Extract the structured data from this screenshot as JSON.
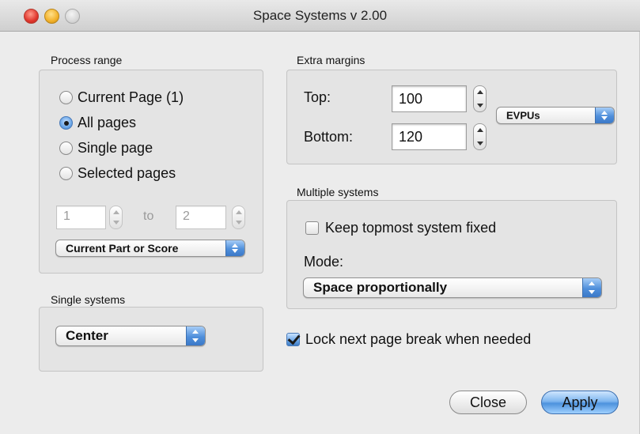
{
  "window": {
    "title": "Space Systems  v 2.00"
  },
  "process_range": {
    "label": "Process range",
    "options": [
      {
        "label": "Current Page (1)",
        "selected": false
      },
      {
        "label": "All pages",
        "selected": true
      },
      {
        "label": "Single page",
        "selected": false
      },
      {
        "label": "Selected pages",
        "selected": false
      }
    ],
    "from_value": "1",
    "to_label": "to",
    "to_value": "2",
    "scope_popup": "Current Part or Score"
  },
  "single_systems": {
    "label": "Single systems",
    "mode_popup": "Center"
  },
  "extra_margins": {
    "label": "Extra margins",
    "top_label": "Top:",
    "top_value": "100",
    "bottom_label": "Bottom:",
    "bottom_value": "120",
    "units_popup": "EVPUs"
  },
  "multiple_systems": {
    "label": "Multiple systems",
    "keep_fixed_label": "Keep topmost system fixed",
    "keep_fixed_checked": false,
    "mode_label": "Mode:",
    "mode_popup": "Space proportionally"
  },
  "lock_page_break": {
    "label": "Lock next page break when needed",
    "checked": true
  },
  "buttons": {
    "close": "Close",
    "apply": "Apply"
  },
  "colors": {
    "accent": "#4f8fdb",
    "window_bg": "#ececec"
  }
}
